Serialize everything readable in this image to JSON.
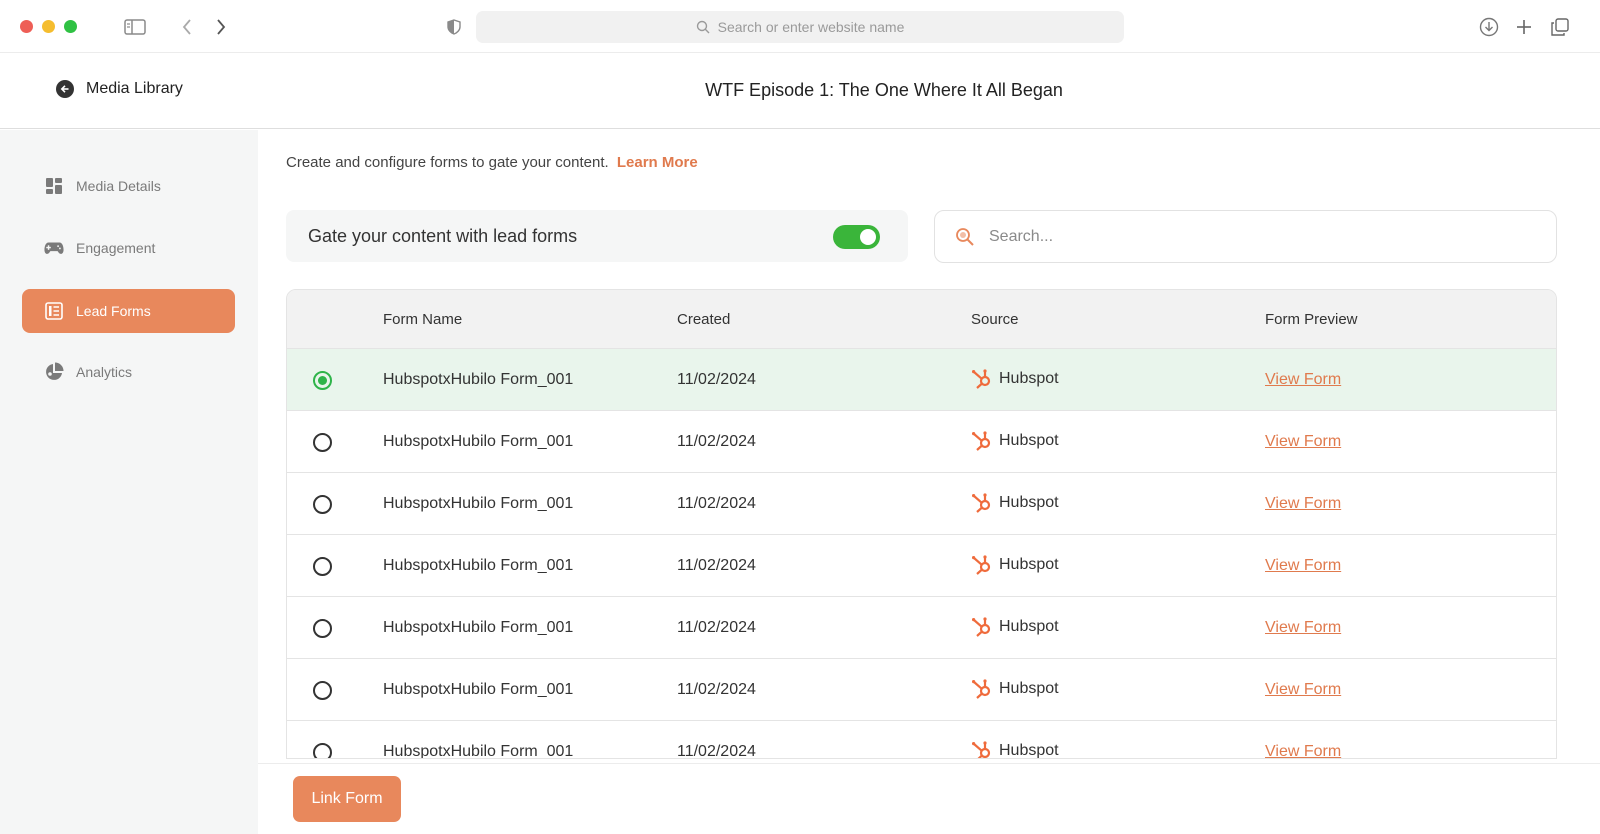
{
  "browser": {
    "url_placeholder": "Search or enter website name"
  },
  "header": {
    "back_label": "Media Library",
    "title": "WTF Episode 1: The One Where It All Began"
  },
  "sidebar": {
    "items": [
      {
        "label": "Media Details",
        "icon": "grid-icon"
      },
      {
        "label": "Engagement",
        "icon": "gamepad-icon"
      },
      {
        "label": "Lead Forms",
        "icon": "form-icon",
        "active": true
      },
      {
        "label": "Analytics",
        "icon": "pie-chart-icon"
      }
    ]
  },
  "main": {
    "intro_text": "Create and configure forms to gate your content.",
    "learn_more": "Learn More",
    "gate_label": "Gate your content with lead forms",
    "gate_enabled": true,
    "search_placeholder": "Search..."
  },
  "table": {
    "columns": [
      "Form Name",
      "Created",
      "Source",
      "Form Preview"
    ],
    "rows": [
      {
        "name": "HubspotxHubilo Form_001",
        "created": "11/02/2024",
        "source": "Hubspot",
        "preview": "View Form",
        "selected": true
      },
      {
        "name": "HubspotxHubilo Form_001",
        "created": "11/02/2024",
        "source": "Hubspot",
        "preview": "View Form",
        "selected": false
      },
      {
        "name": "HubspotxHubilo Form_001",
        "created": "11/02/2024",
        "source": "Hubspot",
        "preview": "View Form",
        "selected": false
      },
      {
        "name": "HubspotxHubilo Form_001",
        "created": "11/02/2024",
        "source": "Hubspot",
        "preview": "View Form",
        "selected": false
      },
      {
        "name": "HubspotxHubilo Form_001",
        "created": "11/02/2024",
        "source": "Hubspot",
        "preview": "View Form",
        "selected": false
      },
      {
        "name": "HubspotxHubilo Form_001",
        "created": "11/02/2024",
        "source": "Hubspot",
        "preview": "View Form",
        "selected": false
      },
      {
        "name": "HubspotxHubilo Form_001",
        "created": "11/02/2024",
        "source": "Hubspot",
        "preview": "View Form",
        "selected": false
      }
    ]
  },
  "footer": {
    "link_button": "Link Form"
  },
  "colors": {
    "accent": "#e8885c",
    "link": "#e07a4d",
    "toggle_on": "#3ab53a",
    "selected_row": "#e9f5ec"
  }
}
